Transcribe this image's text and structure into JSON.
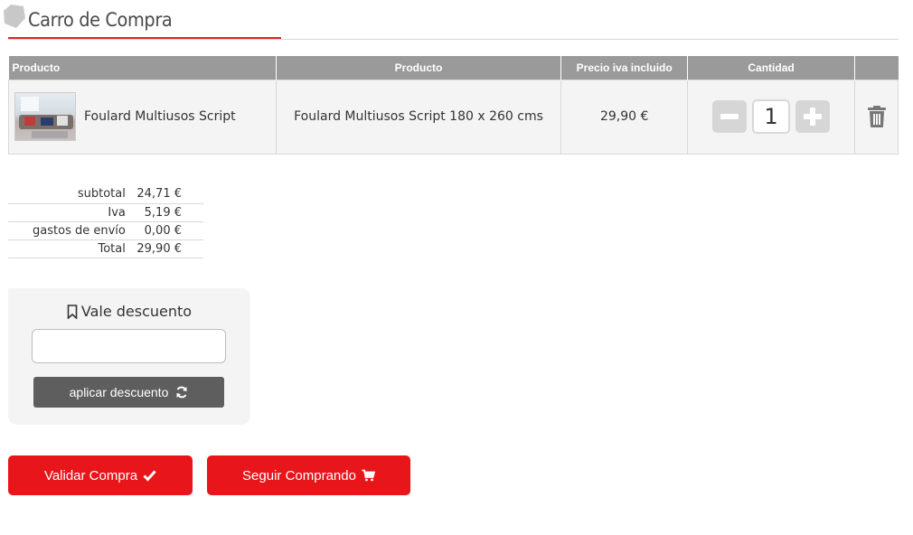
{
  "header": {
    "title": "Carro de Compra"
  },
  "cart": {
    "columns": [
      "Producto",
      "Producto",
      "Precio iva incluido",
      "Cantidad",
      ""
    ],
    "items": [
      {
        "name": "Foulard Multiusos Script",
        "description": "Foulard Multiusos Script 180 x 260 cms",
        "price": "29,90 €",
        "quantity": "1"
      }
    ]
  },
  "totals": [
    {
      "label": "subtotal",
      "value": "24,71 €"
    },
    {
      "label": "Iva",
      "value": "5,19 €"
    },
    {
      "label": "gastos de envío",
      "value": "0,00 €"
    },
    {
      "label": "Total",
      "value": "29,90 €"
    }
  ],
  "discount": {
    "title": "Vale descuento",
    "input_value": "",
    "input_placeholder": "",
    "apply_label": "aplicar descuento"
  },
  "actions": {
    "validate_label": "Validar Compra",
    "continue_label": "Seguir Comprando"
  },
  "icons": {
    "title": "hexagon-icon",
    "minus": "minus-icon",
    "plus": "plus-icon",
    "delete": "trash-icon",
    "discount": "bookmark-icon",
    "apply": "refresh-icon",
    "validate": "check-icon",
    "continue": "cart-icon"
  },
  "colors": {
    "accent": "#e8151b",
    "header_bg": "#9a9a9a",
    "apply_bg": "#5e5e5e"
  }
}
